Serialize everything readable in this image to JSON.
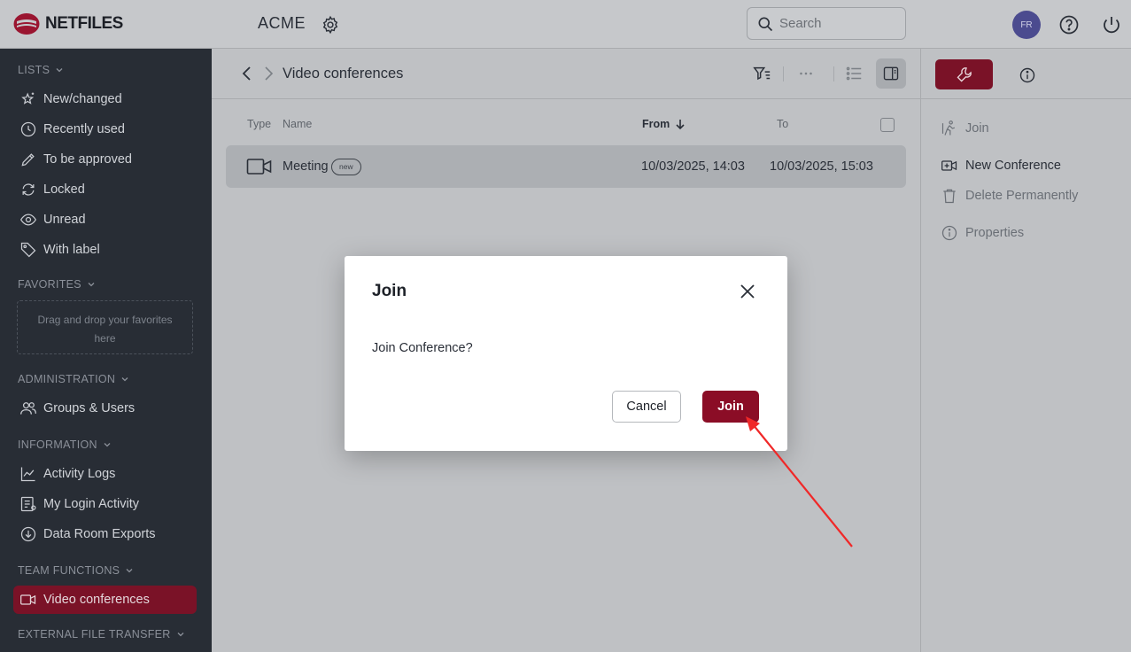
{
  "header": {
    "logo_text": "NETFILES",
    "workspace": "ACME",
    "search_placeholder": "Search",
    "avatar_initials": "FR"
  },
  "sidebar": {
    "lists_title": "LISTS",
    "lists": [
      {
        "label": "New/changed",
        "icon": "star-sparkle-icon"
      },
      {
        "label": "Recently used",
        "icon": "clock-icon"
      },
      {
        "label": "To be approved",
        "icon": "pencil-icon"
      },
      {
        "label": "Locked",
        "icon": "sync-icon"
      },
      {
        "label": "Unread",
        "icon": "eye-icon"
      },
      {
        "label": "With label",
        "icon": "tag-icon"
      }
    ],
    "favorites_title": "FAVORITES",
    "favorites_placeholder": "Drag and drop your favorites here",
    "administration_title": "ADMINISTRATION",
    "administration": [
      {
        "label": "Groups & Users",
        "icon": "users-icon"
      }
    ],
    "information_title": "INFORMATION",
    "information": [
      {
        "label": "Activity Logs",
        "icon": "chart-icon"
      },
      {
        "label": "My Login Activity",
        "icon": "login-list-icon"
      },
      {
        "label": "Data Room Exports",
        "icon": "download-circle-icon"
      }
    ],
    "team_title": "TEAM FUNCTIONS",
    "team": [
      {
        "label": "Video conferences",
        "icon": "video-icon",
        "active": true
      }
    ],
    "external_title": "EXTERNAL FILE TRANSFER"
  },
  "main": {
    "breadcrumb_title": "Video conferences",
    "columns": {
      "type": "Type",
      "name": "Name",
      "from": "From",
      "to": "To"
    },
    "rows": [
      {
        "name": "Meeting",
        "badge": "new",
        "from": "10/03/2025, 14:03",
        "to": "10/03/2025, 15:03"
      }
    ]
  },
  "right_panel": {
    "actions": [
      {
        "label": "Join",
        "enabled": false
      },
      {
        "label": "New Conference",
        "enabled": true
      },
      {
        "label": "Delete Permanently",
        "enabled": false
      },
      {
        "label": "Properties",
        "enabled": false
      }
    ]
  },
  "modal": {
    "title": "Join",
    "body": "Join Conference?",
    "cancel_label": "Cancel",
    "join_label": "Join"
  },
  "colors": {
    "accent": "#8b0d26",
    "sidebar_bg": "#282d35",
    "annotation_arrow": "#f02828"
  }
}
